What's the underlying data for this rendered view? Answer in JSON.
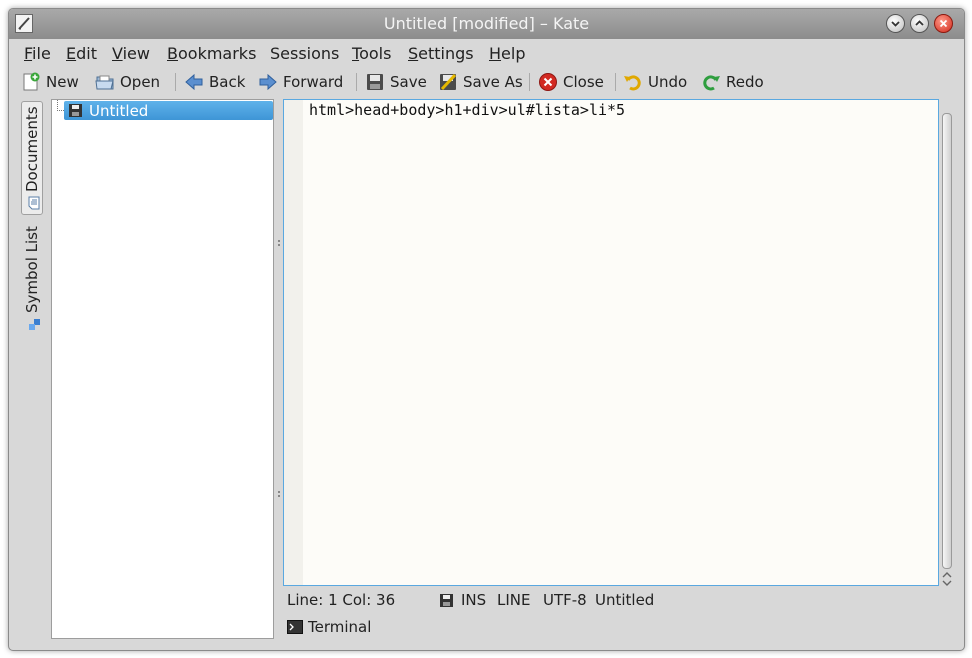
{
  "window": {
    "title": "Untitled [modified] – Kate",
    "buttons": [
      "minimize-icon",
      "maximize-icon",
      "close-icon"
    ]
  },
  "menubar": {
    "items": [
      {
        "label": "File",
        "accel": "F",
        "rest": "ile"
      },
      {
        "label": "Edit",
        "accel": "E",
        "rest": "dit"
      },
      {
        "label": "View",
        "accel": "V",
        "rest": "iew"
      },
      {
        "label": "Bookmarks",
        "accel": "B",
        "rest": "ookmarks"
      },
      {
        "label": "Sessions",
        "accel": "",
        "rest": "Sessions"
      },
      {
        "label": "Tools",
        "accel": "T",
        "rest": "ools"
      },
      {
        "label": "Settings",
        "accel": "S",
        "rest": "ettings"
      },
      {
        "label": "Help",
        "accel": "H",
        "rest": "elp"
      }
    ]
  },
  "toolbar": {
    "new": "New",
    "open": "Open",
    "back": "Back",
    "forward": "Forward",
    "save": "Save",
    "save_as": "Save As",
    "close": "Close",
    "undo": "Undo",
    "redo": "Redo"
  },
  "sidebar": {
    "tabs": [
      "Documents",
      "Symbol List"
    ],
    "active_tab": "Documents"
  },
  "documents": {
    "items": [
      {
        "name": "Untitled",
        "selected": true
      }
    ]
  },
  "editor": {
    "lines": [
      "html>head+body>h1+div>ul#lista>li*5"
    ]
  },
  "status": {
    "position": "Line: 1 Col: 36",
    "mode": "INS",
    "selection": "LINE",
    "encoding": "UTF-8",
    "doc_name": "Untitled"
  },
  "bottom_panel": {
    "terminal": "Terminal"
  },
  "colors": {
    "selection": "#3e95d6",
    "editor_bg": "#fdfcf8",
    "focus_border": "#5aa8e0",
    "window_bg": "#d8d8d8"
  }
}
